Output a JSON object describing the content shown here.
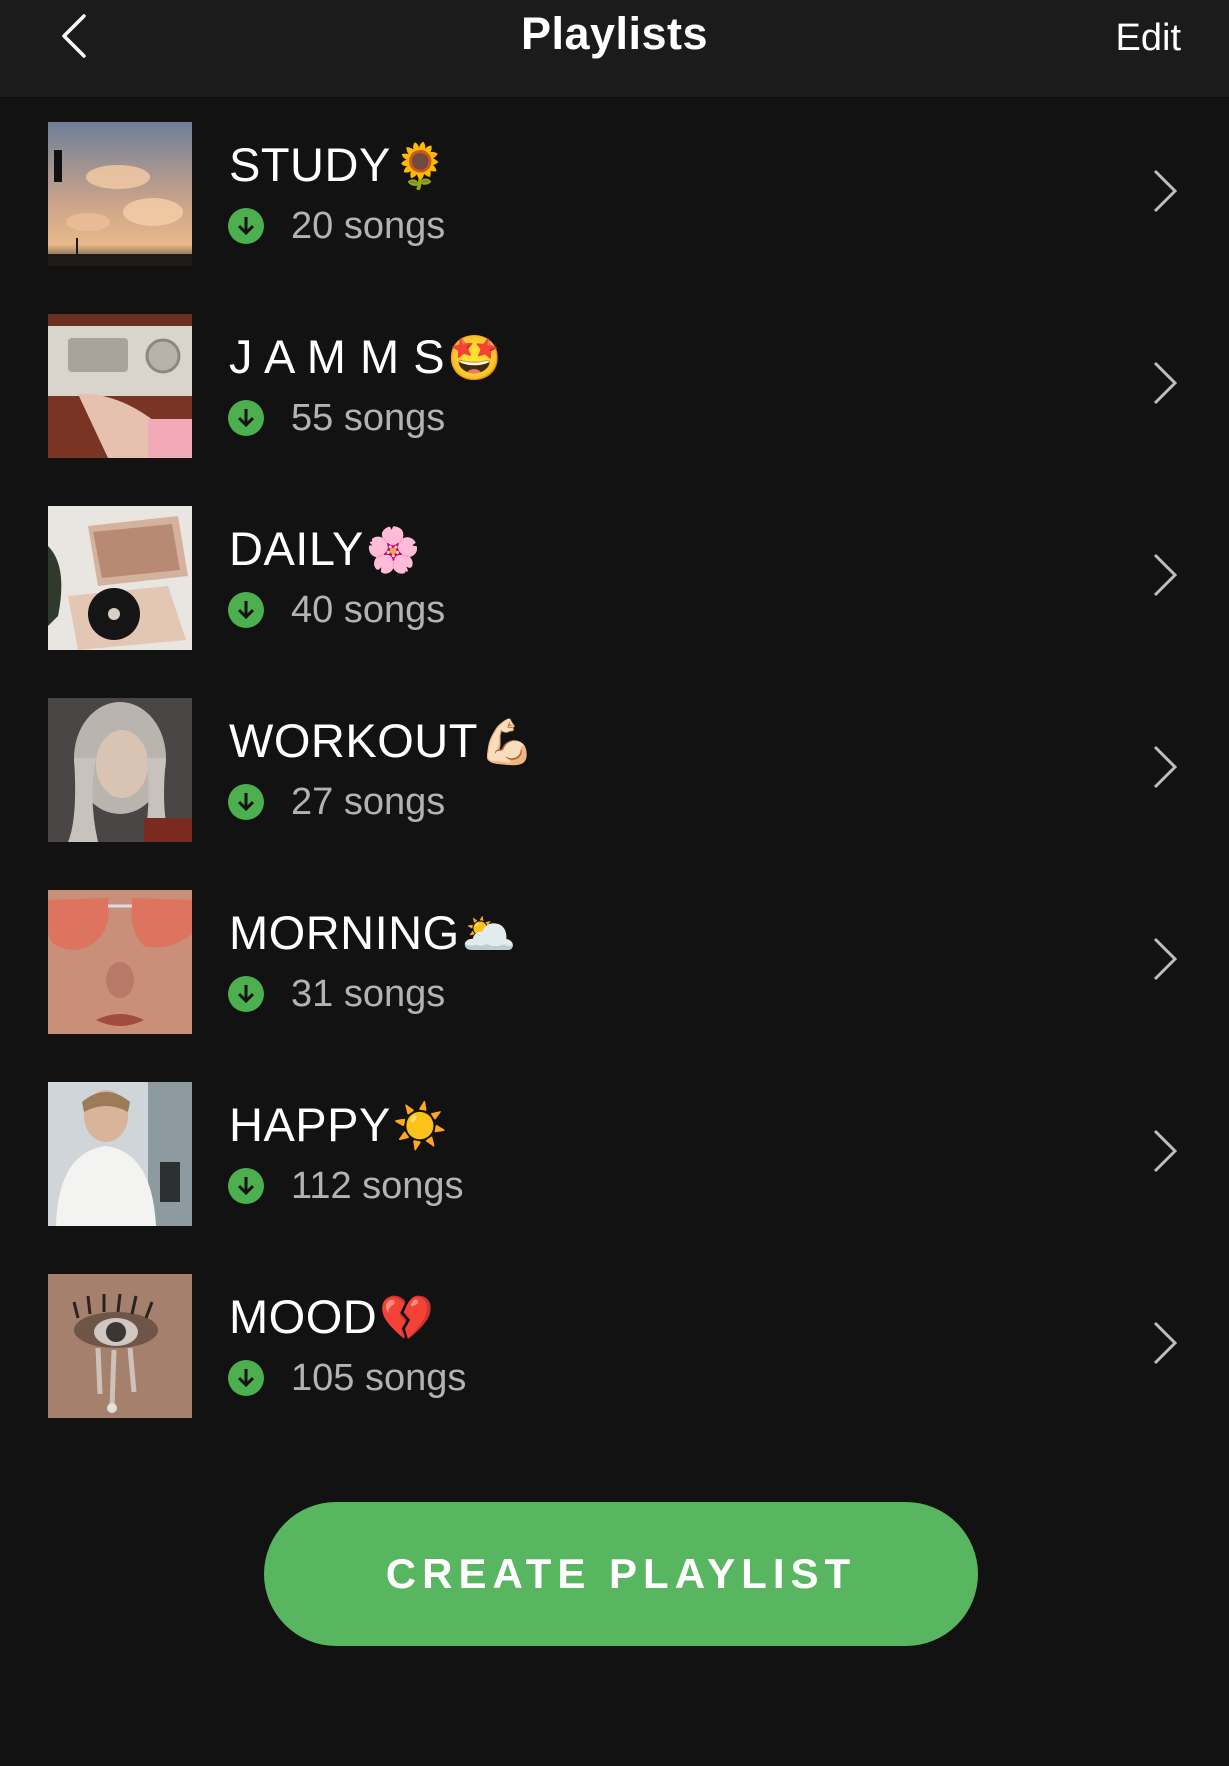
{
  "header": {
    "title": "Playlists",
    "edit_label": "Edit",
    "back_icon": "chevron-left-icon"
  },
  "colors": {
    "background": "#121212",
    "header_bg": "#1b1b1b",
    "accent_green": "#57b65f",
    "download_green": "#4caf50",
    "subtext": "#b3b3b3"
  },
  "playlists": [
    {
      "title": "STUDY",
      "emoji": "🌻",
      "count": "20 songs",
      "cover": "sunset-sky"
    },
    {
      "title": "J A M M S",
      "emoji": "🤩",
      "count": "55 songs",
      "cover": "car-radio"
    },
    {
      "title": "DAILY",
      "emoji": "🌸",
      "count": "40 songs",
      "cover": "record-player"
    },
    {
      "title": "WORKOUT",
      "emoji": "💪🏻",
      "count": "27 songs",
      "cover": "portrait-grey-hair"
    },
    {
      "title": "MORNING",
      "emoji": "🌥️",
      "count": "31 songs",
      "cover": "heart-sunglasses"
    },
    {
      "title": "HAPPY",
      "emoji": "☀️",
      "count": "112 songs",
      "cover": "portrait-white-shirt"
    },
    {
      "title": "MOOD",
      "emoji": "💔",
      "count": "105 songs",
      "cover": "eye-tears"
    }
  ],
  "create_button": {
    "label": "CREATE PLAYLIST"
  }
}
